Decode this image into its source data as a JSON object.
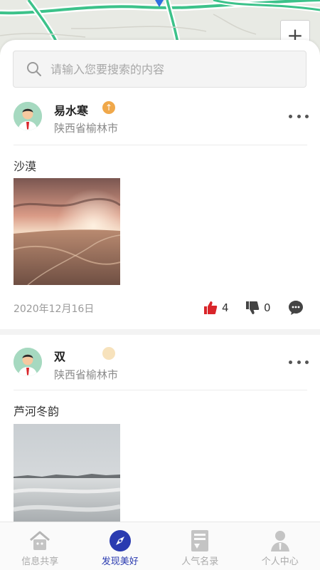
{
  "search": {
    "placeholder": "请输入您要搜索的内容"
  },
  "map": {
    "zoom_in_label": "+"
  },
  "posts": [
    {
      "username": "易水寒",
      "location": "陕西省榆林市",
      "title": "沙漠",
      "date": "2020年12月16日",
      "likes": "4",
      "dislikes": "0"
    },
    {
      "username": "双",
      "location": "陕西省榆林市",
      "title": "芦河冬韵"
    }
  ],
  "tabs": [
    {
      "label": "信息共享",
      "icon": "house-icon"
    },
    {
      "label": "发现美好",
      "icon": "compass-icon"
    },
    {
      "label": "人气名录",
      "icon": "list-icon"
    },
    {
      "label": "个人中心",
      "icon": "person-icon"
    }
  ],
  "colors": {
    "accent": "#2a3bb0",
    "like": "#d9252a",
    "road": "#3cc28a",
    "badge": "#f0a84a"
  }
}
